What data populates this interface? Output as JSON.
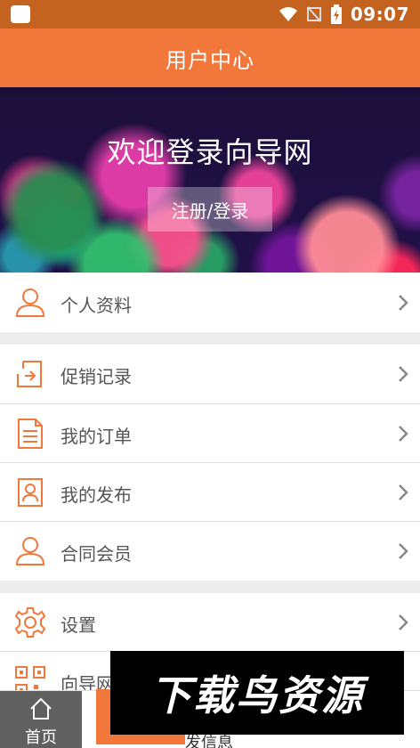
{
  "status": {
    "time": "09:07"
  },
  "header": {
    "title": "用户中心"
  },
  "hero": {
    "title": "欢迎登录向导网",
    "button_label": "注册/登录"
  },
  "menu": {
    "profile": {
      "label": "个人资料",
      "icon": "person-icon"
    },
    "promo": {
      "label": "促销记录",
      "icon": "export-icon"
    },
    "orders": {
      "label": "我的订单",
      "icon": "document-icon"
    },
    "posts": {
      "label": "我的发布",
      "icon": "contact-card-icon"
    },
    "members": {
      "label": "合同会员",
      "icon": "person-icon"
    },
    "settings": {
      "label": "设置",
      "icon": "gear-icon"
    },
    "guide": {
      "label": "向导网",
      "icon": "qr-code-icon"
    }
  },
  "bottom_nav": {
    "home": "首页",
    "publish": "发信息"
  },
  "watermark": {
    "text": "下载鸟资源"
  },
  "colors": {
    "accent": "#f2773a",
    "status_bar": "#c4631f"
  }
}
